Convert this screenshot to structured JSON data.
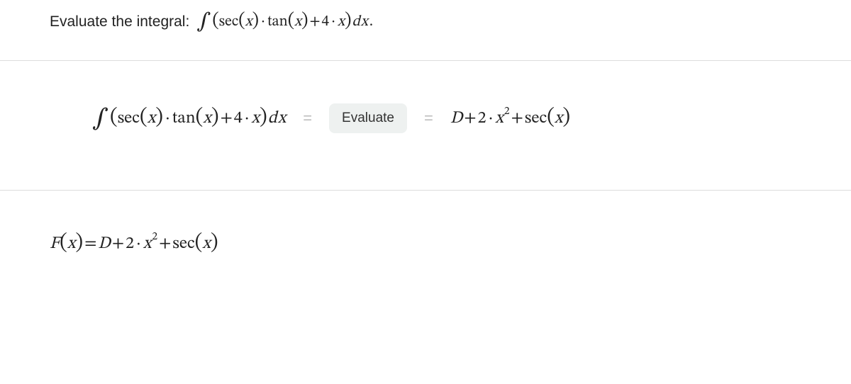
{
  "problem": {
    "intro_text": "Evaluate the integral:",
    "variable": "x",
    "integral_expr": {
      "int_symbol": "∫",
      "open": "(",
      "close": ")",
      "sec": "sec",
      "tan": "tan",
      "dot": "·",
      "plus": "+",
      "coef": "4",
      "dx_d": "d",
      "period": "."
    }
  },
  "evaluate": {
    "button_label": "Evaluate",
    "eq": "=",
    "result": {
      "const_D": "D",
      "plus": "+",
      "coef": "2",
      "dot": "·",
      "var": "x",
      "exp": "2",
      "sec": "sec",
      "open": "(",
      "close": ")"
    }
  },
  "second": {
    "F": "F",
    "open": "(",
    "close": ")",
    "var": "x",
    "eq": "=",
    "const_D": "D",
    "plus": "+",
    "coef": "2",
    "dot": "·",
    "exp": "2",
    "sec": "sec"
  }
}
